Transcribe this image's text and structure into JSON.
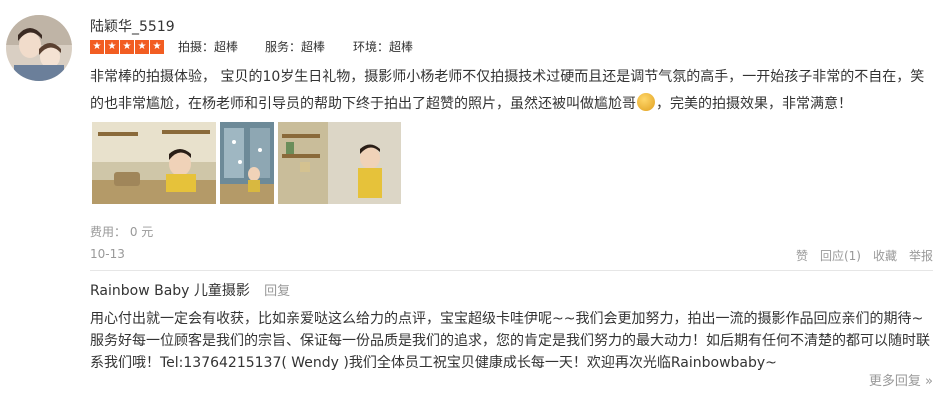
{
  "review": {
    "username": "陆颖华_5519",
    "stars": 5,
    "ratings": [
      "拍摄：超棒",
      "服务：超棒",
      "环境：超棒"
    ],
    "text_part1": "非常棒的拍摄体验， 宝贝的10岁生日礼物，摄影师小杨老师不仅拍摄技术过硬而且还是调节气氛的高手，一开始孩子非常的不自在，笑的也非常尴尬，在杨老师和引导员的帮助下终于拍出了超赞的照片，虽然还被叫做尴尬哥",
    "text_part2": "，完美的拍摄效果，非常满意！",
    "cost": "费用： 0 元",
    "date": "10-13",
    "actions": {
      "like": "赞",
      "reply": "回应(1)",
      "favorite": "收藏",
      "report": "举报"
    }
  },
  "reply": {
    "shop_name": "Rainbow Baby 儿童摄影",
    "label": "回复",
    "text": "用心付出就一定会有收获，比如亲爱哒这么给力的点评，宝宝超级卡哇伊呢~~我们会更加努力，拍出一流的摄影作品回应亲们的期待~服务好每一位顾客是我们的宗旨、保证每一份品质是我们的追求，您的肯定是我们努力的最大动力！如后期有任何不清楚的都可以随时联系我们哦！Tel:13764215137( Wendy )我们全体员工祝宝贝健康成长每一天！欢迎再次光临Rainbowbaby~"
  },
  "more_replies": "更多回复 »",
  "colors": {
    "star": "#f25d22",
    "muted": "#999999",
    "text": "#333333"
  }
}
